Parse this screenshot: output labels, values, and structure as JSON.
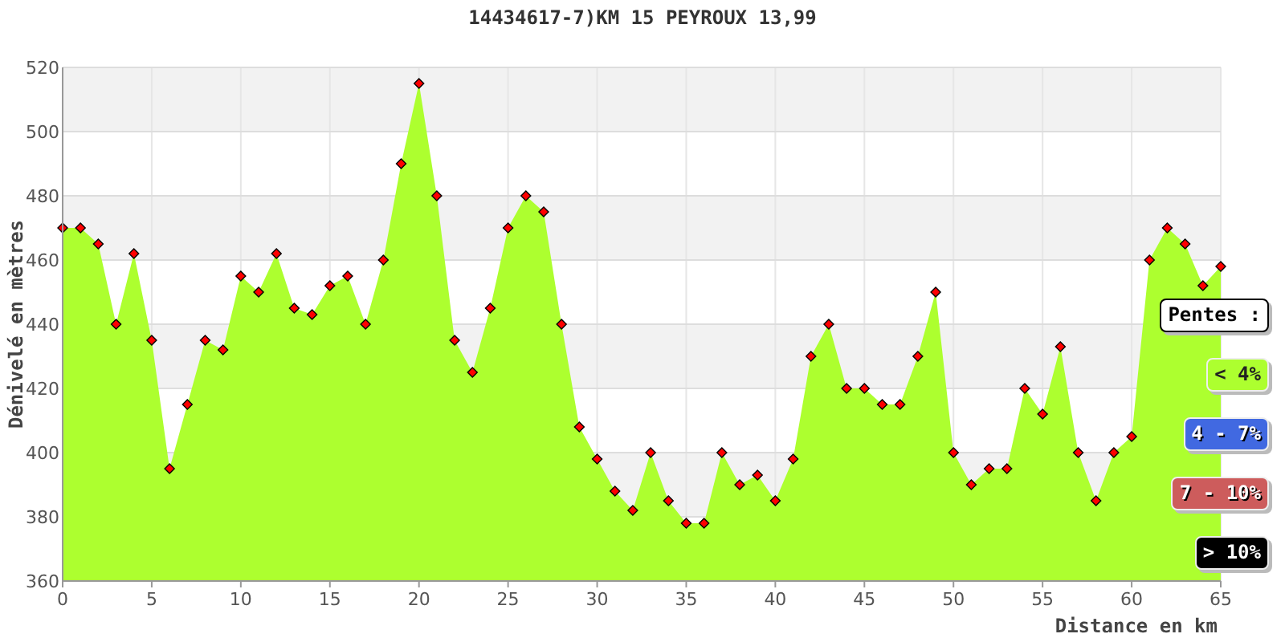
{
  "chart": {
    "chart_data": {
      "type": "area",
      "title": "14434617-7)KM 15 PEYROUX 13,99",
      "xlabel": "Distance en km",
      "ylabel": "Dénivelé en mètres",
      "x": [
        0,
        1,
        2,
        3,
        4,
        5,
        6,
        7,
        8,
        9,
        10,
        11,
        12,
        13,
        14,
        15,
        16,
        17,
        18,
        19,
        20,
        21,
        22,
        23,
        24,
        25,
        26,
        27,
        28,
        29,
        30,
        31,
        32,
        33,
        34,
        35,
        36,
        37,
        38,
        39,
        40,
        41,
        42,
        43,
        44,
        45,
        46,
        47,
        48,
        49,
        50,
        51,
        52,
        53,
        54,
        55,
        56,
        57,
        58,
        59,
        60,
        61,
        62,
        63,
        64,
        65
      ],
      "grid": true,
      "series": [
        {
          "color": "#adff2f",
          "values": [
            470,
            470,
            465,
            440,
            462,
            435,
            395,
            415,
            435,
            432,
            455,
            450,
            462,
            445,
            443,
            452,
            455,
            440,
            460,
            490,
            515,
            480,
            435,
            425,
            445,
            470,
            480,
            475,
            440,
            408,
            398,
            388,
            382,
            400,
            385,
            378,
            378,
            400,
            390,
            393,
            385,
            398,
            430,
            440,
            420,
            420,
            415,
            415,
            430,
            450,
            400,
            390,
            395,
            395,
            420,
            412,
            433,
            400,
            385,
            400,
            405,
            460,
            470,
            465,
            452,
            458
          ]
        }
      ],
      "xlim": [
        0,
        65
      ],
      "ylim": [
        360,
        520
      ],
      "xticks": [
        0,
        5,
        10,
        15,
        20,
        25,
        30,
        35,
        40,
        45,
        50,
        55,
        60,
        65
      ],
      "yticks": [
        360,
        380,
        400,
        420,
        440,
        460,
        480,
        500,
        520
      ]
    },
    "legend": {
      "title": "Pentes :",
      "items": [
        {
          "label": "< 4%",
          "color": "#adff2f"
        },
        {
          "label": "4 - 7%",
          "color": "#4169e1"
        },
        {
          "label": "7 - 10%",
          "color": "#cd5c5c"
        },
        {
          "label": "> 10%",
          "color": "#000000"
        }
      ]
    }
  }
}
